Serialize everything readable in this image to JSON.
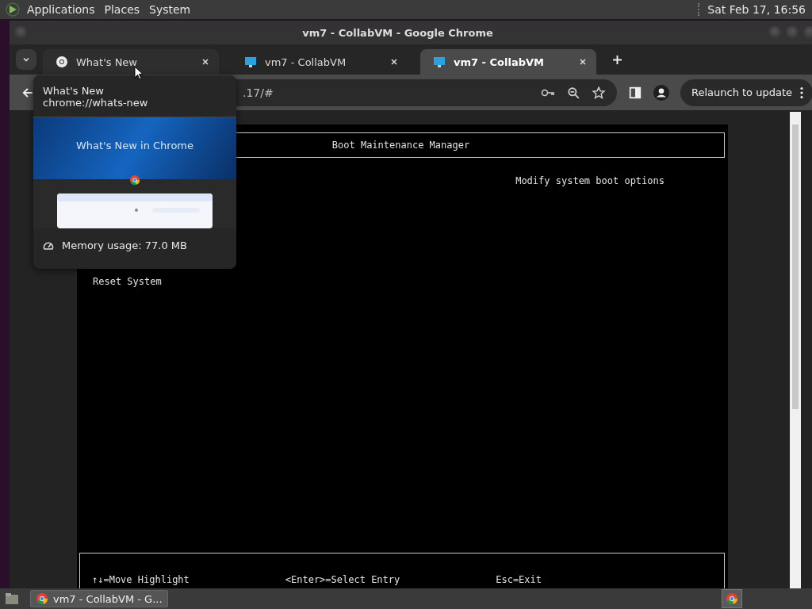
{
  "top_panel": {
    "menus": [
      "Applications",
      "Places",
      "System"
    ],
    "clock": "Sat Feb 17, 16:56"
  },
  "window": {
    "title": "vm7 - CollabVM - Google Chrome"
  },
  "tabs": [
    {
      "label": "What's New",
      "kind": "chrome",
      "selected": false
    },
    {
      "label": "vm7 - CollabVM",
      "kind": "monitor",
      "selected": false
    },
    {
      "label": "vm7 - CollabVM",
      "kind": "monitor",
      "selected": true
    }
  ],
  "address_bar": {
    "value": ".17/#"
  },
  "relaunch_button": "Relaunch to update",
  "hover_card": {
    "title": "What's New",
    "url": "chrome://whats-new",
    "preview_title": "What's New in Chrome",
    "memory": "Memory usage: 77.0 MB"
  },
  "vm_screen": {
    "header": "Boot Maintenance Manager",
    "help": "Modify system boot options",
    "items": [
      "Reset System"
    ],
    "footer": [
      "↑↓=Move Highlight",
      "<Enter>=Select Entry",
      "Esc=Exit"
    ]
  },
  "taskbar": {
    "task": "vm7 - CollabVM - G..."
  }
}
